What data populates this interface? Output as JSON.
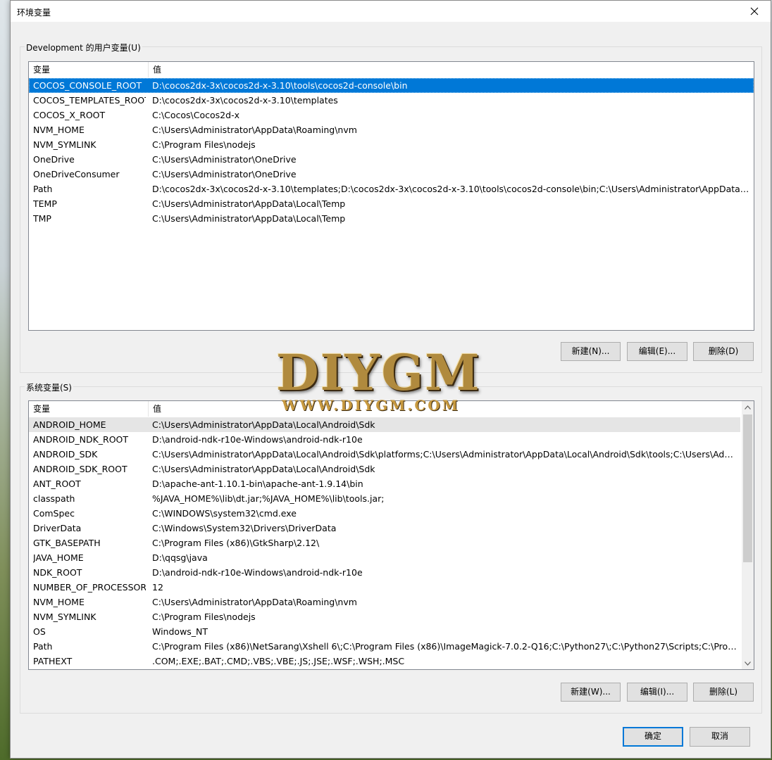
{
  "window": {
    "title": "环境变量"
  },
  "user_vars": {
    "group_label": "Development 的用户变量(U)",
    "columns": [
      "变量",
      "值"
    ],
    "rows": [
      {
        "name": "COCOS_CONSOLE_ROOT",
        "value": "D:\\cocos2dx-3x\\cocos2d-x-3.10\\tools\\cocos2d-console\\bin"
      },
      {
        "name": "COCOS_TEMPLATES_ROOT",
        "value": "D:\\cocos2dx-3x\\cocos2d-x-3.10\\templates"
      },
      {
        "name": "COCOS_X_ROOT",
        "value": "C:\\Cocos\\Cocos2d-x"
      },
      {
        "name": "NVM_HOME",
        "value": "C:\\Users\\Administrator\\AppData\\Roaming\\nvm"
      },
      {
        "name": "NVM_SYMLINK",
        "value": "C:\\Program Files\\nodejs"
      },
      {
        "name": "OneDrive",
        "value": "C:\\Users\\Administrator\\OneDrive"
      },
      {
        "name": "OneDriveConsumer",
        "value": "C:\\Users\\Administrator\\OneDrive"
      },
      {
        "name": "Path",
        "value": "D:\\cocos2dx-3x\\cocos2d-x-3.10\\templates;D:\\cocos2dx-3x\\cocos2d-x-3.10\\tools\\cocos2d-console\\bin;C:\\Users\\Administrator\\AppData\\Local\\M..."
      },
      {
        "name": "TEMP",
        "value": "C:\\Users\\Administrator\\AppData\\Local\\Temp"
      },
      {
        "name": "TMP",
        "value": "C:\\Users\\Administrator\\AppData\\Local\\Temp"
      }
    ],
    "buttons": {
      "new": "新建(N)...",
      "edit": "编辑(E)...",
      "delete": "删除(D)"
    }
  },
  "sys_vars": {
    "group_label": "系统变量(S)",
    "columns": [
      "变量",
      "值"
    ],
    "rows": [
      {
        "name": "ANDROID_HOME",
        "value": "C:\\Users\\Administrator\\AppData\\Local\\Android\\Sdk"
      },
      {
        "name": "ANDROID_NDK_ROOT",
        "value": "D:\\android-ndk-r10e-Windows\\android-ndk-r10e"
      },
      {
        "name": "ANDROID_SDK",
        "value": "C:\\Users\\Administrator\\AppData\\Local\\Android\\Sdk\\platforms;C:\\Users\\Administrator\\AppData\\Local\\Android\\Sdk\\tools;C:\\Users\\Administr..."
      },
      {
        "name": "ANDROID_SDK_ROOT",
        "value": "C:\\Users\\Administrator\\AppData\\Local\\Android\\Sdk"
      },
      {
        "name": "ANT_ROOT",
        "value": "D:\\apache-ant-1.10.1-bin\\apache-ant-1.9.14\\bin"
      },
      {
        "name": "classpath",
        "value": "%JAVA_HOME%\\lib\\dt.jar;%JAVA_HOME%\\lib\\tools.jar;"
      },
      {
        "name": "ComSpec",
        "value": "C:\\WINDOWS\\system32\\cmd.exe"
      },
      {
        "name": "DriverData",
        "value": "C:\\Windows\\System32\\Drivers\\DriverData"
      },
      {
        "name": "GTK_BASEPATH",
        "value": "C:\\Program Files (x86)\\GtkSharp\\2.12\\"
      },
      {
        "name": "JAVA_HOME",
        "value": "D:\\qqsg\\java"
      },
      {
        "name": "NDK_ROOT",
        "value": "D:\\android-ndk-r10e-Windows\\android-ndk-r10e"
      },
      {
        "name": "NUMBER_OF_PROCESSORS",
        "value": "12"
      },
      {
        "name": "NVM_HOME",
        "value": "C:\\Users\\Administrator\\AppData\\Roaming\\nvm"
      },
      {
        "name": "NVM_SYMLINK",
        "value": "C:\\Program Files\\nodejs"
      },
      {
        "name": "OS",
        "value": "Windows_NT"
      },
      {
        "name": "Path",
        "value": "C:\\Program Files (x86)\\NetSarang\\Xshell 6\\;C:\\Program Files (x86)\\ImageMagick-7.0.2-Q16;C:\\Python27\\;C:\\Python27\\Scripts;C:\\Program Files..."
      },
      {
        "name": "PATHEXT",
        "value": ".COM;.EXE;.BAT;.CMD;.VBS;.VBE;.JS;.JSE;.WSF;.WSH;.MSC"
      }
    ],
    "buttons": {
      "new": "新建(W)...",
      "edit": "编辑(I)...",
      "delete": "删除(L)"
    }
  },
  "footer": {
    "ok": "确定",
    "cancel": "取消"
  },
  "watermark": {
    "big": "DIYGM",
    "small": "WWW.DIYGM.COM"
  },
  "colors": {
    "selection": "#0078d7",
    "hover": "#e5e5e5",
    "window_bg": "#f0f0f0"
  },
  "icons": {
    "close": "close-icon",
    "scroll_up": "chevron-up-icon",
    "scroll_down": "chevron-down-icon"
  }
}
